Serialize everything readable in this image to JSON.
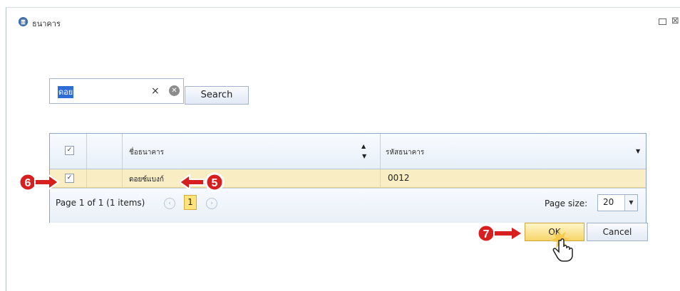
{
  "window": {
    "title": "ธนาคาร",
    "title_icon": "building-icon",
    "maximize_icon": "maximize-icon",
    "close_icon": "close-icon"
  },
  "search": {
    "value": "ดอย",
    "clear_text": "×",
    "button_label": "Search"
  },
  "grid": {
    "columns": [
      {
        "name": "ชื่อธนาคาร"
      },
      {
        "name": "รหัสธนาคาร"
      }
    ],
    "rows": [
      {
        "selected": true,
        "name": "ดอยซ์แบงก์",
        "code": "0012"
      }
    ],
    "pager": {
      "summary": "Page 1 of 1 (1 items)",
      "current_page": "1",
      "page_size_label": "Page size:",
      "page_size": "20"
    }
  },
  "buttons": {
    "ok": "OK",
    "cancel": "Cancel"
  },
  "annotations": {
    "step_5": "5",
    "step_6": "6",
    "step_7": "7"
  },
  "colors": {
    "accent_red": "#d71f1f",
    "selection_row": "#f8edc3",
    "ok_button": "#f7d66b"
  }
}
